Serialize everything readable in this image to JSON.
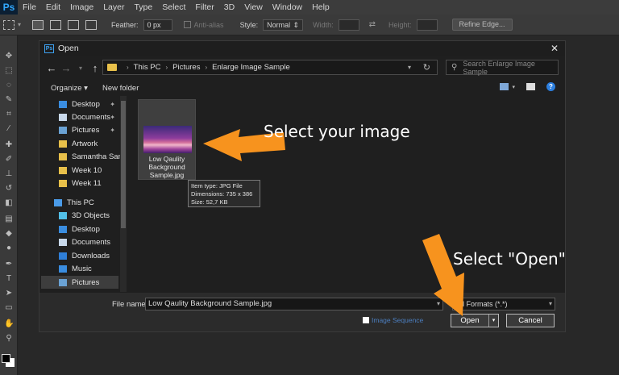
{
  "app": {
    "logo": "Ps",
    "menus": [
      "File",
      "Edit",
      "Image",
      "Layer",
      "Type",
      "Select",
      "Filter",
      "3D",
      "View",
      "Window",
      "Help"
    ]
  },
  "options_bar": {
    "feather_label": "Feather:",
    "feather_value": "0 px",
    "antialias_label": "Anti-alias",
    "style_label": "Style:",
    "style_value": "Normal",
    "width_label": "Width:",
    "height_label": "Height:",
    "refine_edge": "Refine Edge..."
  },
  "dialog": {
    "title_icon": "Ps",
    "title": "Open",
    "breadcrumb": [
      "This PC",
      "Pictures",
      "Enlarge Image Sample"
    ],
    "search_placeholder": "Search Enlarge Image Sample",
    "organize": "Organize ▾",
    "new_folder": "New folder",
    "nav_items": [
      {
        "label": "Desktop",
        "icon": "desktop-icon",
        "pinned": true
      },
      {
        "label": "Documents",
        "icon": "documents-icon",
        "pinned": true
      },
      {
        "label": "Pictures",
        "icon": "pictures-icon",
        "pinned": true
      },
      {
        "label": "Artwork",
        "icon": "folder-icon"
      },
      {
        "label": "Samantha Samp",
        "icon": "folder-icon"
      },
      {
        "label": "Week 10",
        "icon": "folder-icon"
      },
      {
        "label": "Week 11",
        "icon": "folder-icon"
      },
      {
        "label": "This PC",
        "icon": "pc-icon"
      },
      {
        "label": "3D Objects",
        "icon": "3d-objects-icon"
      },
      {
        "label": "Desktop",
        "icon": "desktop-icon"
      },
      {
        "label": "Documents",
        "icon": "documents-icon"
      },
      {
        "label": "Downloads",
        "icon": "downloads-icon"
      },
      {
        "label": "Music",
        "icon": "music-icon"
      },
      {
        "label": "Pictures",
        "icon": "pictures-icon",
        "selected": true
      }
    ],
    "file": {
      "name_line1": "Low Qaulity",
      "name_line2": "Background",
      "name_line3": "Sample.jpg"
    },
    "tooltip": {
      "type": "Item type: JPG File",
      "dimensions": "Dimensions: 735 x 386",
      "size": "Size: 52,7 KB"
    },
    "file_name_label": "File name:",
    "file_name_value": "Low Qaulity Background Sample.jpg",
    "filter_value": "All Formats (*.*)",
    "image_sequence": "Image Sequence",
    "open_button": "Open",
    "cancel_button": "Cancel"
  },
  "annotations": {
    "select_image": "Select your image",
    "select_open": "Select \"Open\"",
    "arrow_color": "#f7931e"
  }
}
